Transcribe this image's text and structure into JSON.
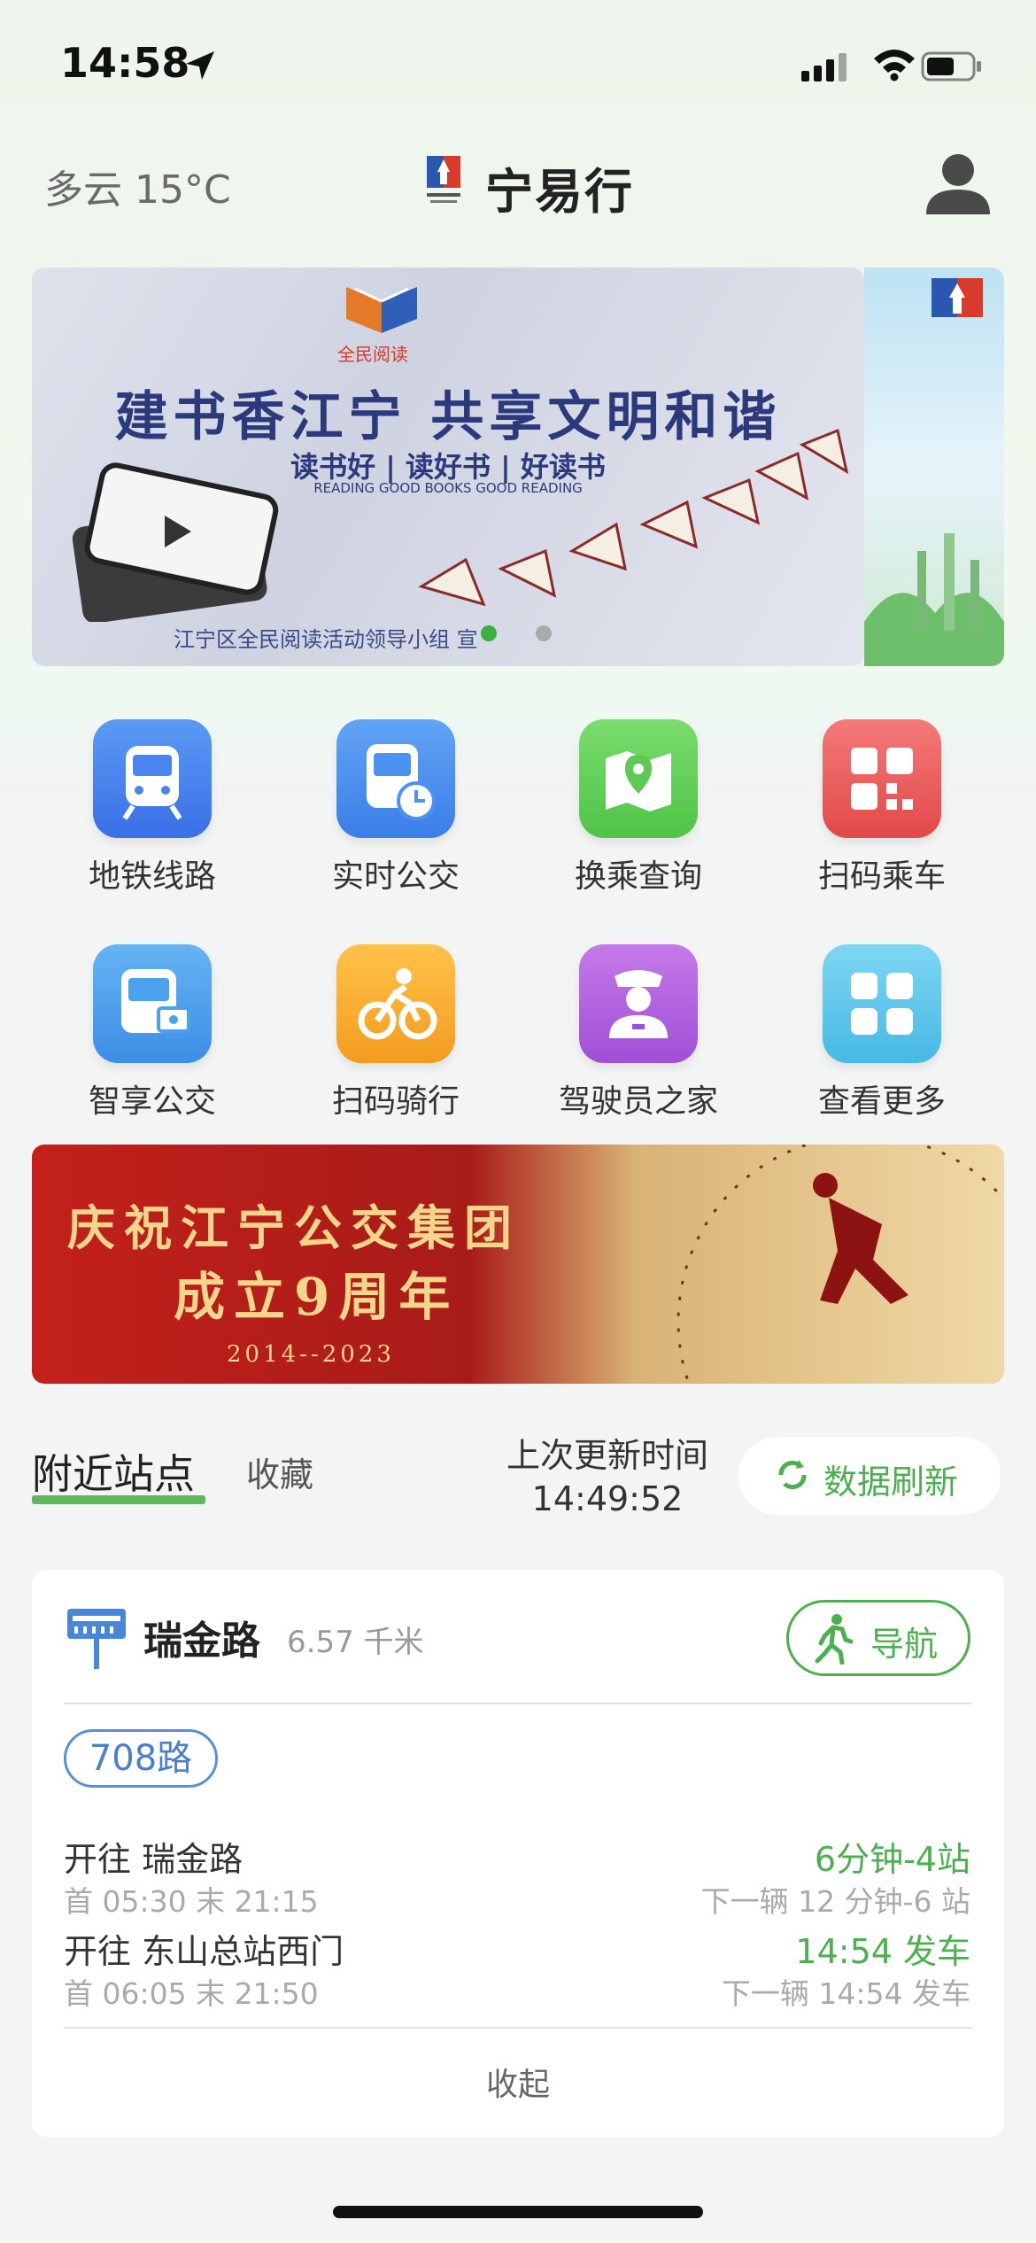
{
  "status_bar": {
    "time": "14:58"
  },
  "header": {
    "weather": "多云 15°C",
    "title": "宁易行"
  },
  "banner": {
    "headline": "建书香江宁 共享文明和谐",
    "sub": "读书好 | 读好书 | 好读书",
    "sub_en": "READING GOOD BOOKS GOOD READING",
    "logo_text": "全民阅读",
    "footer": "江宁区全民阅读活动领导小组 宣"
  },
  "grid": {
    "items": [
      {
        "label": "地铁线路",
        "icon": "metro-icon",
        "color": "#4a84f0"
      },
      {
        "label": "实时公交",
        "icon": "realtime-bus-icon",
        "color": "#4b92f2"
      },
      {
        "label": "换乘查询",
        "icon": "map-pin-icon",
        "color": "#66cf5e"
      },
      {
        "label": "扫码乘车",
        "icon": "qr-code-icon",
        "color": "#ef6060"
      },
      {
        "label": "智享公交",
        "icon": "smart-bus-icon",
        "color": "#4aa2ee"
      },
      {
        "label": "扫码骑行",
        "icon": "bike-icon",
        "color": "#f5a623"
      },
      {
        "label": "驾驶员之家",
        "icon": "driver-icon",
        "color": "#b561e0"
      },
      {
        "label": "查看更多",
        "icon": "more-grid-icon",
        "color": "#4cc2ea"
      }
    ]
  },
  "promo": {
    "line1": "庆祝江宁公交集团",
    "line2": "成立9周年",
    "years": "2014--2023"
  },
  "tabs": {
    "nearby": "附近站点",
    "favorites": "收藏"
  },
  "update": {
    "label": "上次更新时间",
    "time": "14:49:52",
    "refresh": "数据刷新"
  },
  "stop": {
    "name": "瑞金路",
    "distance": "6.57 千米",
    "nav_label": "导航",
    "route": "708路",
    "directions": [
      {
        "dest": "开往 瑞金路",
        "hours": "首 05:30 末 21:15",
        "eta": "6分钟-4站",
        "next": "下一辆 12 分钟-6 站"
      },
      {
        "dest": "开往 东山总站西门",
        "hours": "首 06:05 末 21:50",
        "eta": "14:54 发车",
        "next": "下一辆 14:54 发车"
      }
    ],
    "collapse": "收起"
  },
  "colors": {
    "accent_green": "#4caf50",
    "route_blue": "#4a7fcf"
  }
}
